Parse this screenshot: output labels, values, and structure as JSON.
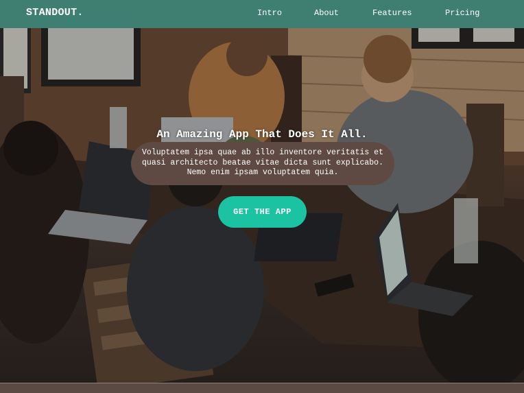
{
  "nav": {
    "brand": "STANDOUT.",
    "links": [
      "Intro",
      "About",
      "Features",
      "Pricing"
    ]
  },
  "hero": {
    "headline": "An Amazing App That Does It All.",
    "description": "Voluptatem ipsa quae ab illo inventore veritatis et quasi architecto beatae vitae dicta sunt explicabo. Nemo enim ipsam voluptatem quia.",
    "cta_label": "GET THE APP",
    "background_image": "team-working-on-laptops-photo"
  },
  "colors": {
    "nav_bg": "#3f7f72",
    "pill_bg": "#5e4a42",
    "cta_bg": "#1bc3a2",
    "footer_bg": "#5a4a43"
  }
}
